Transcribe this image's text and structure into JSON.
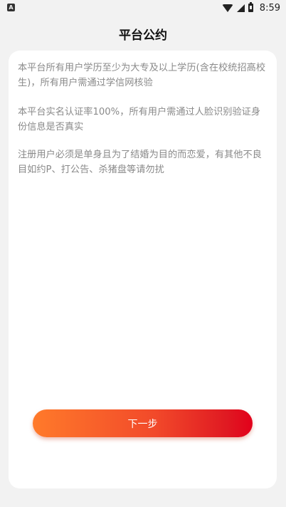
{
  "status_bar": {
    "time": "8:59",
    "notification_icon": "a-icon",
    "icons": [
      "wifi-icon",
      "signal-icon",
      "battery-icon"
    ]
  },
  "header": {
    "title": "平台公约"
  },
  "rules": [
    {
      "text": "本平台所有用户学历至少为大专及以上学历(含在校统招高校生)，所有用户需通过学信网核验"
    },
    {
      "text": "本平台实名认证率100%，所有用户需通过人脸识别验证身份信息是否真实"
    },
    {
      "text": "注册用户必须是单身且为了结婚为目的而恋爱，有其他不良目如约P、打公告、杀猪盘等请勿扰"
    }
  ],
  "actions": {
    "next_label": "下一步"
  },
  "colors": {
    "button_gradient_start": "#ff7a2a",
    "button_gradient_end": "#e2001b",
    "rule_text": "#8a8a8a",
    "background": "#f2f2f2"
  }
}
